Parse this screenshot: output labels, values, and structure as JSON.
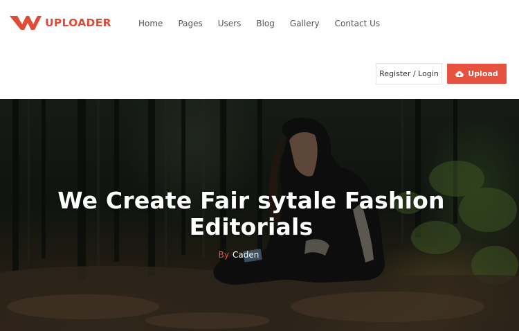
{
  "brand": {
    "name": "UPLOADER",
    "accent_color": "#e7523e"
  },
  "nav": {
    "items": [
      {
        "label": "Home"
      },
      {
        "label": "Pages"
      },
      {
        "label": "Users"
      },
      {
        "label": "Blog"
      },
      {
        "label": "Gallery"
      },
      {
        "label": "Contact Us"
      }
    ]
  },
  "header_actions": {
    "register_label": "Register / Login",
    "upload_label": "Upload",
    "upload_icon": "cloud-upload-icon"
  },
  "hero": {
    "title": "We Create Fair sytale Fashion Editorials",
    "byline_prefix": "By",
    "author": "Caden",
    "image_description_icon": "forest-photo"
  }
}
